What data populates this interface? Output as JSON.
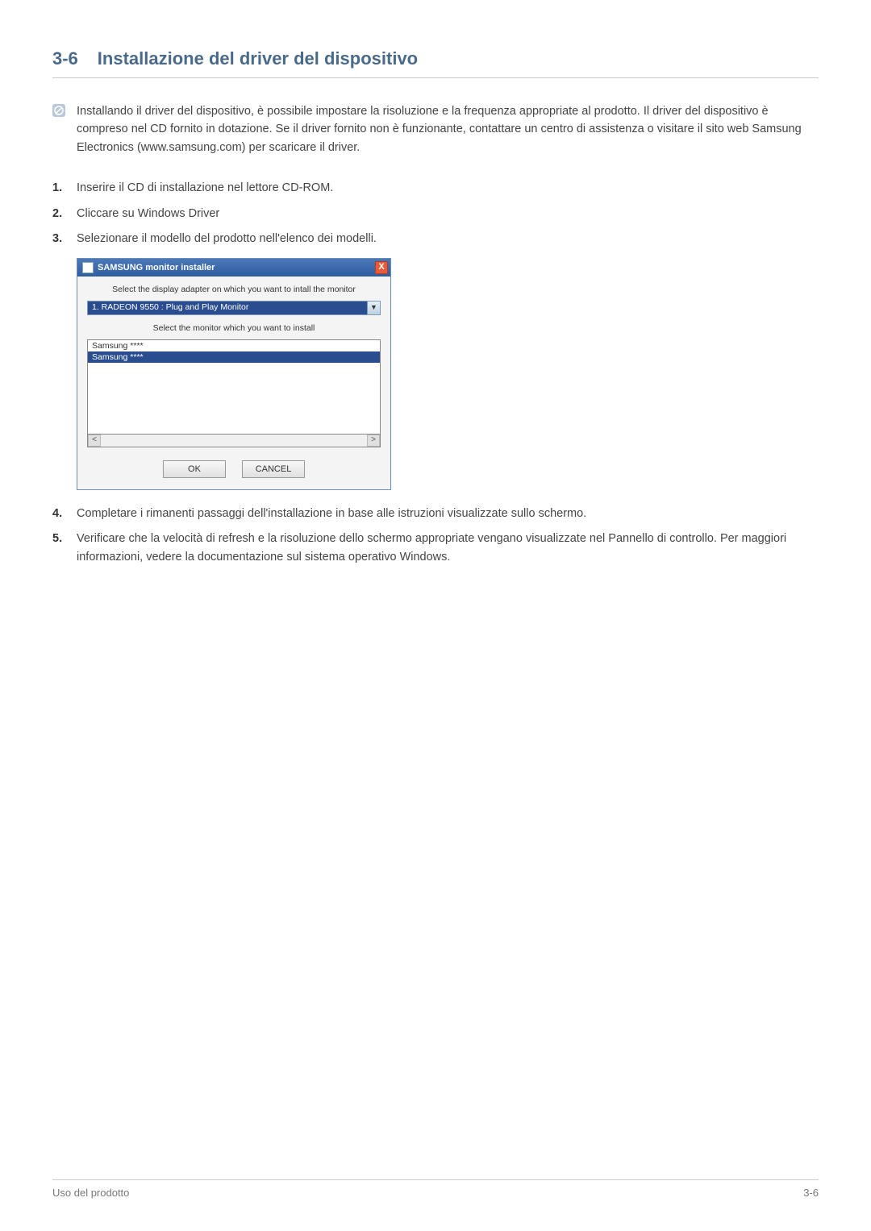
{
  "heading": {
    "number": "3-6",
    "title": "Installazione del driver del dispositivo"
  },
  "note": "Installando il driver del dispositivo, è possibile impostare la risoluzione e la frequenza appropriate al prodotto. Il driver del dispositivo è compreso nel CD fornito in dotazione. Se il driver fornito non è funzionante, contattare un centro di assistenza o visitare il sito web Samsung Electronics (www.samsung.com) per scaricare il driver.",
  "steps": {
    "s1": "Inserire il CD di installazione nel lettore CD-ROM.",
    "s2": "Cliccare su Windows Driver",
    "s3": "Selezionare il modello del prodotto nell'elenco dei modelli.",
    "s4": "Completare i rimanenti passaggi dell'installazione in base alle istruzioni visualizzate sullo schermo.",
    "s5": "Verificare che la velocità di refresh e la risoluzione dello schermo appropriate vengano visualizzate nel Pannello di controllo. Per maggiori informazioni, vedere la documentazione sul sistema operativo Windows."
  },
  "dialog": {
    "title": "SAMSUNG monitor installer",
    "label1": "Select the display adapter on which you want to intall the monitor",
    "dropdown": "1. RADEON 9550 : Plug and Play Monitor",
    "label2": "Select the monitor which you want to install",
    "item1": "Samsung ****",
    "item2": "Samsung ****",
    "ok": "OK",
    "cancel": "CANCEL",
    "close": "X"
  },
  "footer": {
    "left": "Uso del prodotto",
    "right": "3-6"
  }
}
